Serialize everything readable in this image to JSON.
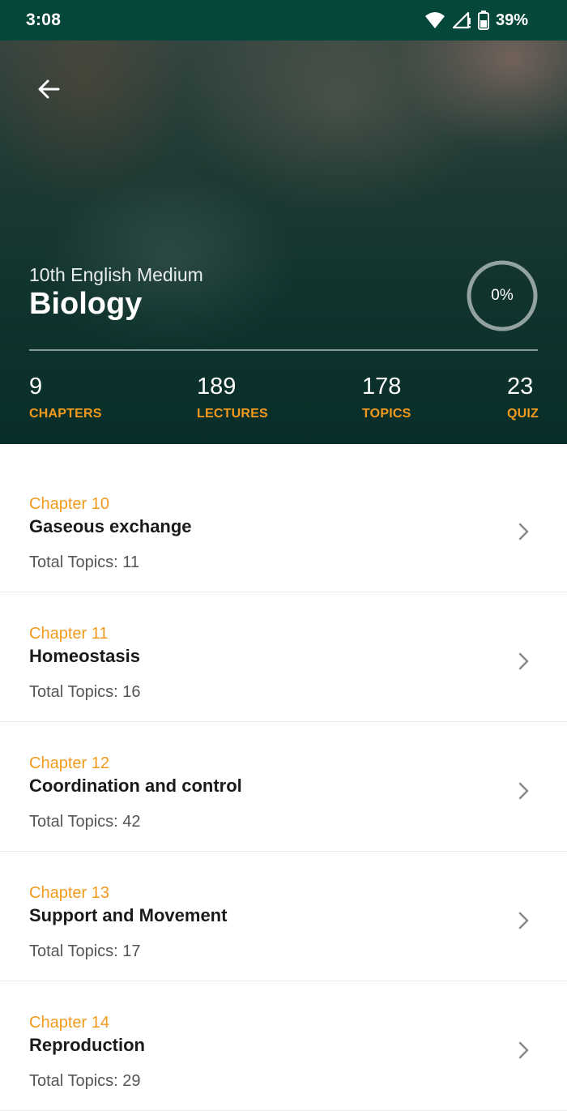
{
  "status_bar": {
    "time": "3:08",
    "battery": "39%",
    "icons": [
      "wifi-icon",
      "signal-icon",
      "battery-icon"
    ]
  },
  "header": {
    "back_icon": "arrow-left-icon",
    "subtitle": "10th English Medium",
    "title": "Biology",
    "progress_text": "0%",
    "progress_fraction": 0
  },
  "stats": [
    {
      "value": "9",
      "label": "CHAPTERS"
    },
    {
      "value": "189",
      "label": "LECTURES"
    },
    {
      "value": "178",
      "label": "TOPICS"
    },
    {
      "value": "23",
      "label": "QUIZ"
    }
  ],
  "chapters": [
    {
      "label": "Chapter 10",
      "title": "Gaseous exchange",
      "topics": "Total Topics: 11"
    },
    {
      "label": "Chapter 11",
      "title": "Homeostasis",
      "topics": "Total Topics: 16"
    },
    {
      "label": "Chapter 12",
      "title": "Coordination and control",
      "topics": "Total Topics: 42"
    },
    {
      "label": "Chapter 13",
      "title": "Support and Movement",
      "topics": "Total Topics: 17"
    },
    {
      "label": "Chapter 14",
      "title": "Reproduction",
      "topics": "Total Topics: 29"
    }
  ],
  "colors": {
    "status_bar": "#06473b",
    "accent": "#f39a1e",
    "title_text": "#1a1a1a",
    "secondary_text": "#555555"
  }
}
